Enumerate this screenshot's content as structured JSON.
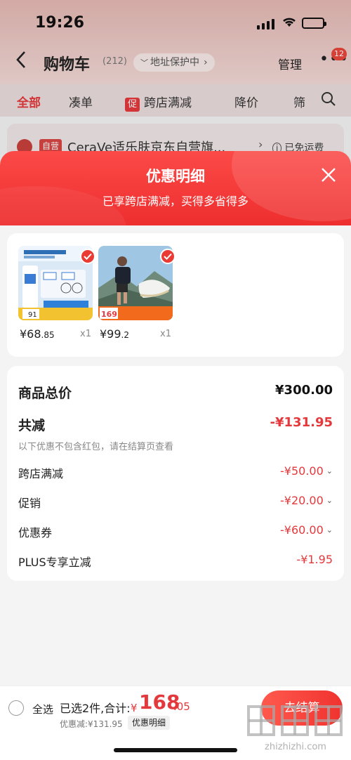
{
  "status_bar": {
    "time": "19:26"
  },
  "nav": {
    "title": "购物车",
    "count": "(212)",
    "address_protection": "地址保护中",
    "manage": "管理",
    "badge": "12"
  },
  "filters": {
    "all": "全部",
    "bundle": "凑单",
    "promo_tag": "促",
    "cross_store": "跨店满减",
    "price_drop": "降价",
    "more": "筛"
  },
  "background_shop": {
    "tag": "自营",
    "name": "CeraVe适乐肤京东自营旗...",
    "shipping": "已免运费"
  },
  "sheet": {
    "title": "优惠明细",
    "subtitle": "已享跨店满减，买得多省得多"
  },
  "products": [
    {
      "price_int": "¥68",
      "price_dec": ".85",
      "qty": "x1",
      "image": "cerave-skincare-box",
      "img_price": "91"
    },
    {
      "price_int": "¥99",
      "price_dec": ".2",
      "qty": "x1",
      "image": "running-shoe-ad",
      "img_price": "169"
    }
  ],
  "summary": {
    "total_label": "商品总价",
    "total_value": "¥300.00",
    "reduction_label": "共减",
    "reduction_value": "-¥131.95",
    "note": "以下优惠不包含红包，请在结算页查看",
    "items": [
      {
        "label": "跨店满减",
        "value": "-¥50.00"
      },
      {
        "label": "促销",
        "value": "-¥20.00"
      },
      {
        "label": "优惠券",
        "value": "-¥60.00"
      },
      {
        "label": "PLUS专享立减",
        "value": "-¥1.95"
      }
    ]
  },
  "bottom_bar": {
    "select_all": "全选",
    "selected_text": "已选2件,合计:",
    "currency": "¥",
    "total_int": "168",
    "total_dec": ".05",
    "discount_text": "优惠减:¥131.95",
    "detail_button": "优惠明细",
    "checkout": "去结算"
  },
  "watermark": {
    "site": "zhizhizhi.com"
  },
  "colors": {
    "accent": "#e4393c",
    "header_red": "#f23b3a",
    "check_red": "#ea3a34"
  }
}
